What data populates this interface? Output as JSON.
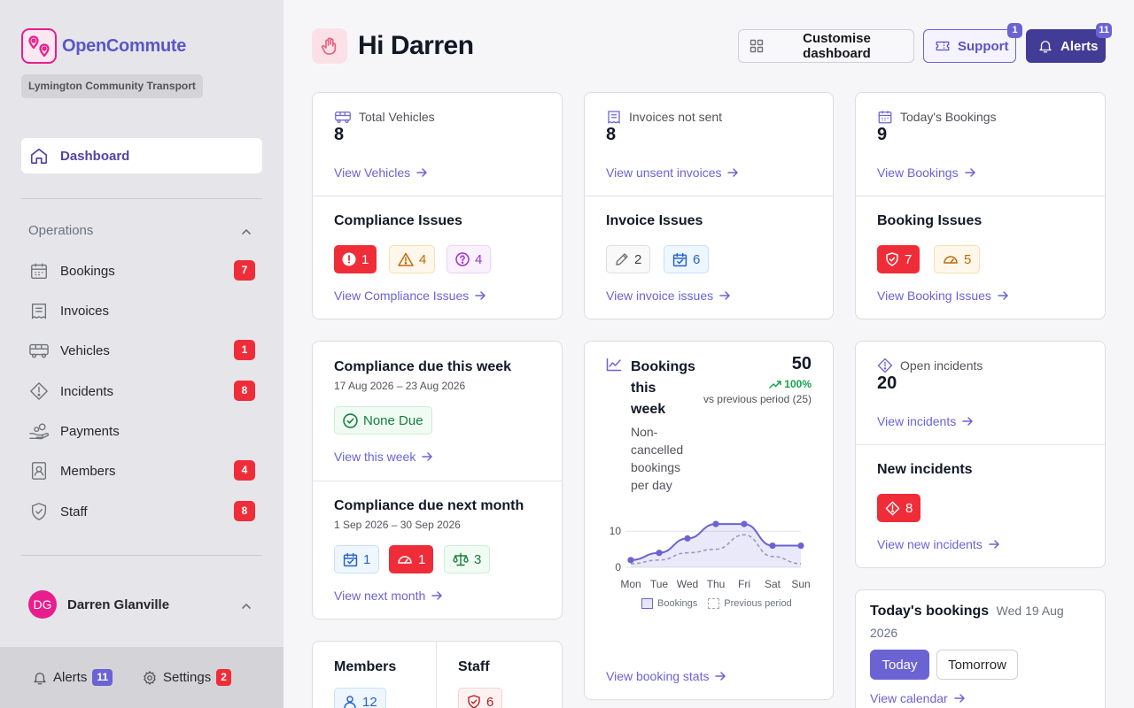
{
  "brand": {
    "name": "OpenCommute",
    "org": "Lymington Community Transport",
    "accent": "#e91e8c",
    "primary": "#5a56c8"
  },
  "sidebar": {
    "dashboard_label": "Dashboard",
    "section_label": "Operations",
    "items": [
      {
        "label": "Bookings",
        "badge": "7",
        "icon": "calendar-icon"
      },
      {
        "label": "Invoices",
        "badge": "",
        "icon": "invoice-icon"
      },
      {
        "label": "Vehicles",
        "badge": "1",
        "icon": "bus-icon"
      },
      {
        "label": "Incidents",
        "badge": "8",
        "icon": "warning-diamond-icon"
      },
      {
        "label": "Payments",
        "badge": "",
        "icon": "hand-coins-icon"
      },
      {
        "label": "Members",
        "badge": "4",
        "icon": "member-card-icon"
      },
      {
        "label": "Staff",
        "badge": "8",
        "icon": "shield-check-icon"
      }
    ],
    "user": {
      "initials": "DG",
      "name": "Darren Glanville"
    },
    "footer": {
      "alerts_label": "Alerts",
      "alerts_count": "11",
      "settings_label": "Settings",
      "settings_count": "2"
    }
  },
  "header": {
    "greeting": "Hi Darren",
    "customise_label": "Customise dashboard",
    "support_label": "Support",
    "support_badge": "1",
    "alerts_label": "Alerts",
    "alerts_badge": "11"
  },
  "cards": {
    "vehicles": {
      "label": "Total Vehicles",
      "value": "8",
      "link": "View Vehicles"
    },
    "compliance_issues": {
      "title": "Compliance Issues",
      "chips": [
        "1",
        "4",
        "4"
      ],
      "link": "View Compliance Issues"
    },
    "invoices": {
      "label": "Invoices not sent",
      "value": "8",
      "link": "View unsent invoices"
    },
    "invoice_issues": {
      "title": "Invoice Issues",
      "chips": [
        "2",
        "6"
      ],
      "link": "View invoice issues"
    },
    "bookings": {
      "label": "Today's Bookings",
      "value": "9",
      "link": "View Bookings"
    },
    "booking_issues": {
      "title": "Booking Issues",
      "chips": [
        "7",
        "5"
      ],
      "link": "View Booking Issues"
    },
    "due_week": {
      "title": "Compliance due this week",
      "range": "17 Aug 2026 – 23 Aug 2026",
      "chip": "None Due",
      "link": "View this week"
    },
    "due_month": {
      "title": "Compliance due next month",
      "range": "1 Sep 2026 – 30 Sep 2026",
      "chips": [
        "1",
        "1",
        "3"
      ],
      "link": "View next month"
    },
    "incidents": {
      "label": "Open incidents",
      "value": "20",
      "link": "View incidents"
    },
    "new_incidents": {
      "title": "New incidents",
      "chip": "8",
      "link": "View new incidents"
    },
    "members_staff": {
      "members_title": "Members",
      "members_value": "12",
      "staff_title": "Staff",
      "staff_value": "6"
    },
    "today_bookings": {
      "title": "Today's bookings",
      "date": "Wed 19 Aug 2026",
      "today_label": "Today",
      "tomorrow_label": "Tomorrow",
      "link": "View calendar"
    },
    "bookings_week": {
      "title_lines": [
        "Bookings",
        "this",
        "week"
      ],
      "subtitle_lines": [
        "Non-",
        "cancelled",
        "bookings",
        "per day"
      ],
      "total": "50",
      "change": "100%",
      "comparison": "vs previous period (25)",
      "link": "View booking stats"
    }
  },
  "chart_data": {
    "type": "line",
    "categories": [
      "Mon",
      "Tue",
      "Wed",
      "Thu",
      "Fri",
      "Sat",
      "Sun"
    ],
    "series": [
      {
        "name": "Bookings",
        "values": [
          2,
          4,
          8,
          12,
          12,
          6,
          6
        ],
        "color": "#6b63d4"
      },
      {
        "name": "Previous period",
        "values": [
          1,
          2,
          4,
          5,
          9,
          3,
          1
        ],
        "color": "#a3a3b8"
      }
    ],
    "yticks": [
      "0",
      "10"
    ],
    "ylim": [
      0,
      13
    ]
  }
}
